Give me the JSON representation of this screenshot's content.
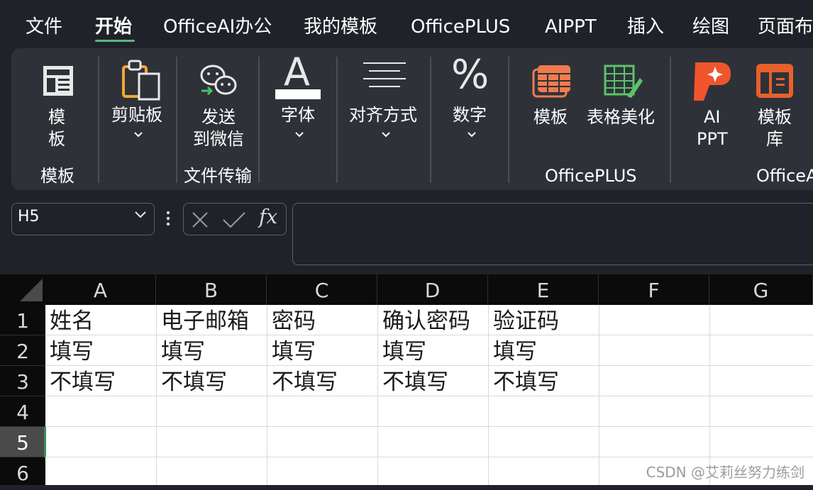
{
  "menu": {
    "tabs": [
      "文件",
      "开始",
      "OfficeAI办公",
      "我的模板",
      "OfficePLUS",
      "AIPPT",
      "插入",
      "绘图",
      "页面布"
    ],
    "active_tab": "开始",
    "accent_color": "#5fb381"
  },
  "ribbon": {
    "template_button": [
      "模",
      "板"
    ],
    "group_template": "模板",
    "clipboard": "剪贴板",
    "send_wechat": [
      "发送",
      "到微信"
    ],
    "group_file_transfer": "文件传输",
    "font_glyph": "A",
    "font": "字体",
    "alignment": "对齐方式",
    "number_glyph": "%",
    "number": "数字",
    "officeplus_template": "模板",
    "table_beautify": "表格美化",
    "group_officeplus": "OfficePLUS",
    "ai_ppt": [
      "AI",
      "PPT"
    ],
    "template_library": [
      "模板",
      "库"
    ],
    "group_officeai": "OfficeA",
    "dropdown_icon": "chevron-down-icon"
  },
  "formula_bar": {
    "name_box": "H5",
    "fx": "fx",
    "formula": ""
  },
  "sheet": {
    "columns": [
      "A",
      "B",
      "C",
      "D",
      "E",
      "F",
      "G"
    ],
    "rows": [
      "1",
      "2",
      "3",
      "4",
      "5",
      "6"
    ],
    "selected_row": "5",
    "cells": [
      [
        "姓名",
        "电子邮箱",
        "密码",
        "确认密码",
        "验证码"
      ],
      [
        "填写",
        "填写",
        "填写",
        "填写",
        "填写"
      ],
      [
        "不填写",
        "不填写",
        "不填写",
        "不填写",
        "不填写"
      ]
    ]
  },
  "watermark": "CSDN @艾莉丝努力练剑"
}
